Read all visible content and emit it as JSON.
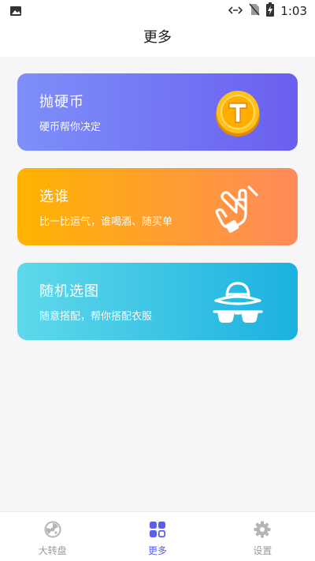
{
  "status_bar": {
    "time": "1:03"
  },
  "header": {
    "title": "更多"
  },
  "cards": [
    {
      "title": "抛硬币",
      "subtitle": "硬币帮你决定",
      "icon": "coin-icon"
    },
    {
      "title": "选谁",
      "subtitle": "比一比运气，谁喝酒、随买单",
      "icon": "pointing-hand-icon"
    },
    {
      "title": "随机选图",
      "subtitle": "随意搭配，帮你搭配衣服",
      "icon": "hat-glasses-icon"
    }
  ],
  "tab_bar": {
    "tabs": [
      {
        "label": "大转盘",
        "icon": "wheel-icon",
        "active": false
      },
      {
        "label": "更多",
        "icon": "grid-icon",
        "active": true
      },
      {
        "label": "设置",
        "icon": "gear-icon",
        "active": false
      }
    ]
  },
  "colors": {
    "accent": "#5a5ff0",
    "card_1": [
      "#7e8ff9",
      "#6a5ff0"
    ],
    "card_2": [
      "#ffb300",
      "#ff8a5b"
    ],
    "card_3": [
      "#5fd9ea",
      "#1bb1e0"
    ]
  }
}
